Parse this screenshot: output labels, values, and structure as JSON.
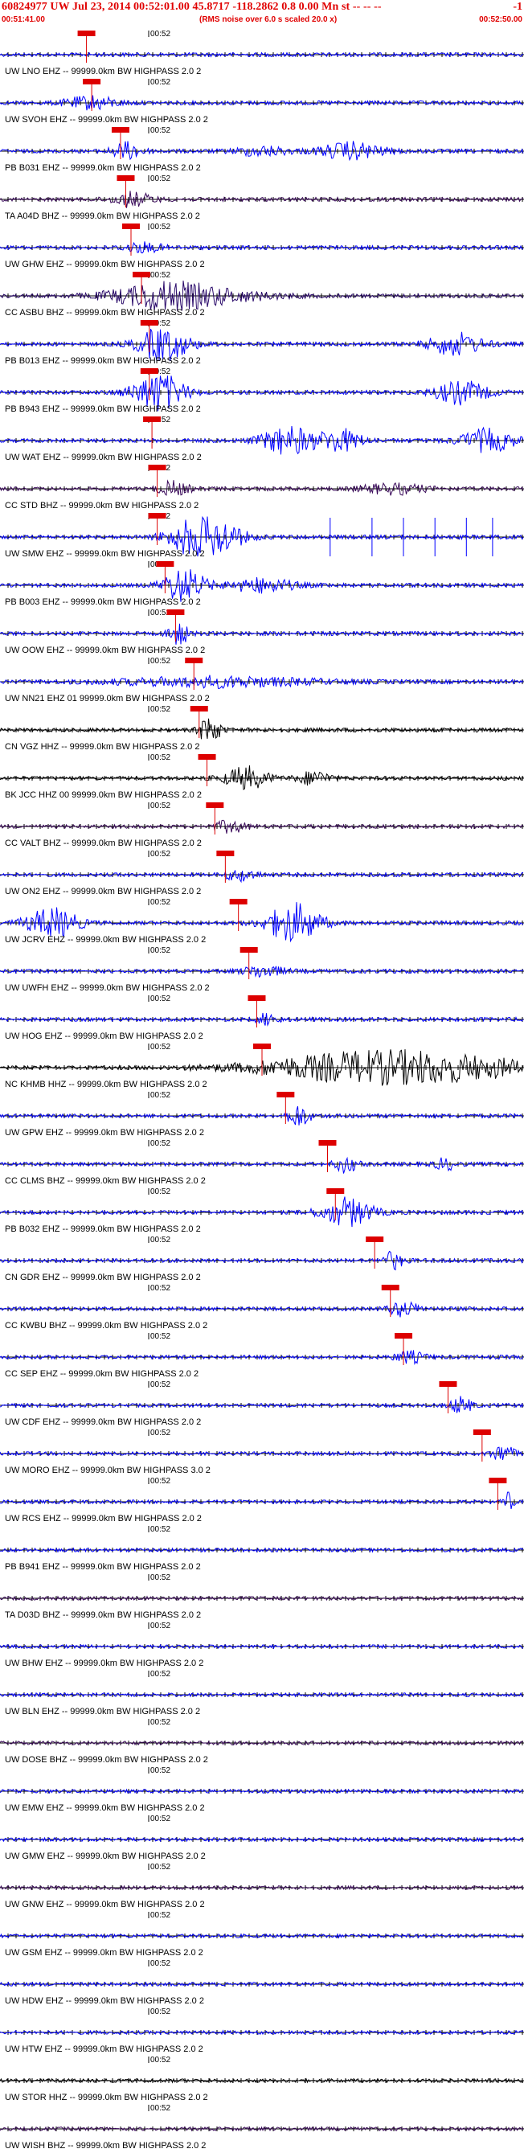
{
  "header": {
    "title": "60824977 UW Jul 23, 2014 00:52:01.00    45.8717  -118.2862  0.8 0.00 Mn st -- -- --",
    "end_mark": "-1",
    "start_time": "00:51:41.00",
    "rms_note": "(RMS noise over 6.0 s scaled 20.0 x)",
    "end_time": "00:52:50.00",
    "colors": {
      "header": "#e00000",
      "pick": "#dd0000"
    }
  },
  "time_tick": "00:52",
  "traces": [
    {
      "label": "UW LNO EHZ -- 99999.0km BW HIGHPASS  2.0  2",
      "color": "#0000ff",
      "pick": 0.165,
      "bursts": []
    },
    {
      "label": "UW SVOH EHZ -- 99999.0km BW HIGHPASS  2.0  2",
      "color": "#0000ff",
      "pick": 0.175,
      "bursts": [
        [
          0.17,
          0.05,
          2.5
        ]
      ]
    },
    {
      "label": "PB B031 EHZ -- 99999.0km BW HIGHPASS  2.0  2",
      "color": "#0000ff",
      "pick": 0.23,
      "bursts": [
        [
          0.24,
          0.03,
          3
        ],
        [
          0.67,
          0.06,
          3
        ],
        [
          0.5,
          0.05,
          1.6
        ]
      ]
    },
    {
      "label": "TA A04D BHZ -- 99999.0km BW HIGHPASS  2.0  2",
      "color": "#3a0a5a",
      "pick": 0.24,
      "bursts": [
        [
          0.25,
          0.04,
          2.5
        ]
      ]
    },
    {
      "label": "UW GHW EHZ -- 99999.0km BW HIGHPASS  2.0  2",
      "color": "#0000ff",
      "pick": 0.25,
      "bursts": [
        [
          0.27,
          0.04,
          1.6
        ]
      ]
    },
    {
      "label": "CC ASBU BHZ -- 99999.0km BW HIGHPASS  2.0  2",
      "color": "#2a0a6a",
      "pick": 0.27,
      "bursts": [
        [
          0.3,
          0.1,
          4
        ],
        [
          0.4,
          0.12,
          2
        ]
      ]
    },
    {
      "label": "PB B013 EHZ -- 99999.0km BW HIGHPASS  2.0  2",
      "color": "#0000ff",
      "pick": 0.285,
      "bursts": [
        [
          0.31,
          0.05,
          6
        ],
        [
          0.87,
          0.05,
          4
        ]
      ]
    },
    {
      "label": "PB B943 EHZ -- 99999.0km BW HIGHPASS  2.0  2",
      "color": "#0000ff",
      "pick": 0.285,
      "bursts": [
        [
          0.3,
          0.05,
          7
        ],
        [
          0.88,
          0.05,
          4
        ]
      ]
    },
    {
      "label": "UW WAT EHZ -- 99999.0km BW HIGHPASS  2.0  2",
      "color": "#0000ff",
      "pick": 0.29,
      "bursts": [
        [
          0.55,
          0.05,
          5
        ],
        [
          0.65,
          0.04,
          4
        ],
        [
          0.93,
          0.05,
          4
        ]
      ]
    },
    {
      "label": "CC STD BHZ -- 99999.0km BW HIGHPASS  2.0  2",
      "color": "#3a0a5a",
      "pick": 0.3,
      "bursts": [
        [
          0.33,
          0.03,
          2.5
        ],
        [
          0.75,
          0.06,
          1.8
        ]
      ]
    },
    {
      "label": "UW SMW EHZ -- 99999.0km BW HIGHPASS  2.0  2",
      "color": "#0000ff",
      "pick": 0.3,
      "bursts": [
        [
          0.39,
          0.06,
          9
        ]
      ],
      "spikes": [
        0.63,
        0.71,
        0.77,
        0.83,
        0.89,
        0.94
      ]
    },
    {
      "label": "PB B003 EHZ -- 99999.0km BW HIGHPASS  2.0  2",
      "color": "#0000ff",
      "pick": 0.315,
      "bursts": [
        [
          0.35,
          0.04,
          6
        ],
        [
          0.5,
          0.06,
          2.5
        ]
      ]
    },
    {
      "label": "UW OOW EHZ -- 99999.0km BW HIGHPASS  2.0  2",
      "color": "#0000ff",
      "pick": 0.335,
      "bursts": [
        [
          0.34,
          0.02,
          4
        ]
      ]
    },
    {
      "label": "UW NN21 EHZ 01 99999.0km BW HIGHPASS  2.0  2",
      "color": "#0000ff",
      "pick": 0.37,
      "bursts": [
        [
          0.4,
          0.2,
          1.8
        ]
      ]
    },
    {
      "label": "CN VGZ HHZ -- 99999.0km BW HIGHPASS  2.0  2",
      "color": "#000000",
      "pick": 0.38,
      "bursts": [
        [
          0.4,
          0.02,
          5
        ]
      ]
    },
    {
      "label": "BK JCC HHZ 00 99999.0km BW HIGHPASS  2.0  2",
      "color": "#000000",
      "pick": 0.395,
      "bursts": [
        [
          0.47,
          0.04,
          4
        ],
        [
          0.6,
          0.03,
          2.5
        ]
      ]
    },
    {
      "label": "CC VALT BHZ -- 99999.0km BW HIGHPASS  2.0  2",
      "color": "#3a0a5a",
      "pick": 0.41,
      "bursts": [
        [
          0.44,
          0.03,
          2
        ]
      ]
    },
    {
      "label": "UW ON2 EHZ -- 99999.0km BW HIGHPASS  2.0  2",
      "color": "#0000ff",
      "pick": 0.43,
      "bursts": [
        [
          0.46,
          0.03,
          2
        ]
      ]
    },
    {
      "label": "UW JCRV EHZ -- 99999.0km BW HIGHPASS  2.0  2",
      "color": "#0000ff",
      "pick": 0.455,
      "bursts": [
        [
          0.1,
          0.05,
          6
        ],
        [
          0.56,
          0.05,
          7
        ]
      ]
    },
    {
      "label": "UW UWFH EHZ -- 99999.0km BW HIGHPASS  2.0  2",
      "color": "#0000ff",
      "pick": 0.475,
      "bursts": [
        [
          0.5,
          0.04,
          2
        ]
      ]
    },
    {
      "label": "UW HOG EHZ -- 99999.0km BW HIGHPASS  2.0  2",
      "color": "#0000ff",
      "pick": 0.49,
      "bursts": [
        [
          0.51,
          0.02,
          2
        ]
      ]
    },
    {
      "label": "NC KHMB HHZ -- 99999.0km BW HIGHPASS  2.0  2",
      "color": "#000000",
      "pick": 0.5,
      "bursts": [
        [
          0.75,
          0.25,
          6
        ]
      ]
    },
    {
      "label": "UW GPW EHZ -- 99999.0km BW HIGHPASS  2.0  2",
      "color": "#0000ff",
      "pick": 0.545,
      "bursts": [
        [
          0.57,
          0.02,
          4
        ]
      ]
    },
    {
      "label": "CC CLMS BHZ -- 99999.0km BW HIGHPASS  2.0  2",
      "color": "#0000ff",
      "pick": 0.625,
      "bursts": [
        [
          0.66,
          0.02,
          3
        ],
        [
          0.85,
          0.02,
          2
        ]
      ]
    },
    {
      "label": "PB B032 EHZ -- 99999.0km BW HIGHPASS  2.0  2",
      "color": "#0000ff",
      "pick": 0.64,
      "bursts": [
        [
          0.66,
          0.05,
          5
        ]
      ]
    },
    {
      "label": "CN GDR EHZ -- 99999.0km BW HIGHPASS  2.0  2",
      "color": "#0000ff",
      "pick": 0.715,
      "bursts": [
        [
          0.75,
          0.02,
          3
        ]
      ]
    },
    {
      "label": "CC KWBU BHZ -- 99999.0km BW HIGHPASS  2.0  2",
      "color": "#0000ff",
      "pick": 0.745,
      "bursts": [
        [
          0.77,
          0.03,
          2.5
        ]
      ]
    },
    {
      "label": "CC SEP EHZ -- 99999.0km BW HIGHPASS  2.0  2",
      "color": "#0000ff",
      "pick": 0.77,
      "bursts": [
        [
          0.78,
          0.03,
          2
        ]
      ]
    },
    {
      "label": "UW CDF EHZ -- 99999.0km BW HIGHPASS  2.0  2",
      "color": "#0000ff",
      "pick": 0.855,
      "bursts": [
        [
          0.88,
          0.02,
          3
        ]
      ]
    },
    {
      "label": "UW MORO EHZ -- 99999.0km BW HIGHPASS  3.0  2",
      "color": "#0000ff",
      "pick": 0.92,
      "bursts": [
        [
          0.96,
          0.02,
          3
        ]
      ]
    },
    {
      "label": "UW RCS EHZ -- 99999.0km BW HIGHPASS  2.0  2",
      "color": "#0000ff",
      "pick": 0.95,
      "bursts": [
        [
          0.97,
          0.01,
          3
        ]
      ]
    },
    {
      "label": "PB B941 EHZ -- 99999.0km BW HIGHPASS  2.0  2",
      "color": "#0000ff",
      "pick": null,
      "bursts": []
    },
    {
      "label": "TA D03D BHZ -- 99999.0km BW HIGHPASS  2.0  2",
      "color": "#3a0a5a",
      "pick": null,
      "bursts": []
    },
    {
      "label": "UW BHW EHZ -- 99999.0km BW HIGHPASS  2.0  2",
      "color": "#0000ff",
      "pick": null,
      "bursts": []
    },
    {
      "label": "UW BLN EHZ -- 99999.0km BW HIGHPASS  2.0  2",
      "color": "#0000ff",
      "pick": null,
      "bursts": []
    },
    {
      "label": "UW DOSE BHZ -- 99999.0km BW HIGHPASS  2.0  2",
      "color": "#3a0a5a",
      "pick": null,
      "bursts": []
    },
    {
      "label": "UW EMW EHZ -- 99999.0km BW HIGHPASS  2.0  2",
      "color": "#0000ff",
      "pick": null,
      "bursts": []
    },
    {
      "label": "UW GMW EHZ -- 99999.0km BW HIGHPASS  2.0  2",
      "color": "#0000ff",
      "pick": null,
      "bursts": []
    },
    {
      "label": "UW GNW EHZ -- 99999.0km BW HIGHPASS  2.0  2",
      "color": "#3a0a5a",
      "pick": null,
      "bursts": []
    },
    {
      "label": "UW GSM EHZ -- 99999.0km BW HIGHPASS  2.0  2",
      "color": "#0000ff",
      "pick": null,
      "bursts": []
    },
    {
      "label": "UW HDW EHZ -- 99999.0km BW HIGHPASS  2.0  2",
      "color": "#0000ff",
      "pick": null,
      "bursts": []
    },
    {
      "label": "UW HTW EHZ -- 99999.0km BW HIGHPASS  2.0  2",
      "color": "#0000ff",
      "pick": null,
      "bursts": []
    },
    {
      "label": "UW STOR HHZ -- 99999.0km BW HIGHPASS  2.0  2",
      "color": "#000000",
      "pick": null,
      "bursts": []
    },
    {
      "label": "UW WISH BHZ -- 99999.0km BW HIGHPASS  2.0  2",
      "color": "#3a0a5a",
      "pick": null,
      "bursts": []
    }
  ]
}
